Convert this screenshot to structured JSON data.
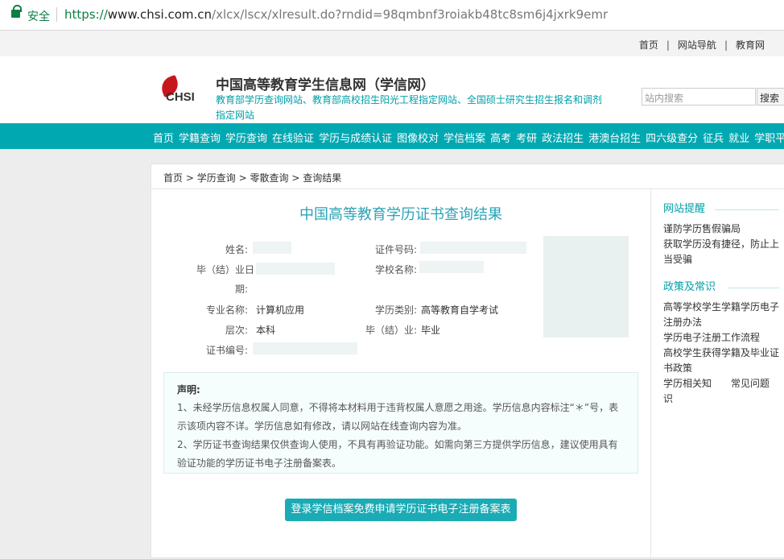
{
  "browser": {
    "secure_label": "安全",
    "url_scheme": "https://",
    "url_domain": "www.chsi.com.cn",
    "url_path": "/xlcx/lscx/xlresult.do?rndid=98qmbnf3roiakb48tc8sm6j4jxrk9emr"
  },
  "topnav": {
    "items": [
      "首页",
      "网站导航",
      "教育网"
    ],
    "divider": "|"
  },
  "header": {
    "logo_text": "CHSI",
    "title": "中国高等教育学生信息网（学信网）",
    "subtitle": "教育部学历查询网站、教育部高校招生阳光工程指定网站、全国硕士研究生招生报名和调剂指定网站",
    "search_placeholder": "站内搜索",
    "search_button": "搜索"
  },
  "mainnav": {
    "items": [
      "首页",
      "学籍查询",
      "学历查询",
      "在线验证",
      "学历与成绩认证",
      "图像校对",
      "学信档案",
      "高考",
      "考研",
      "政法招生",
      "港澳台招生",
      "四六级查分",
      "征兵",
      "就业",
      "学职平台"
    ]
  },
  "breadcrumb": {
    "items": [
      "首页",
      "学历查询",
      "零散查询",
      "查询结果"
    ],
    "sep": ">"
  },
  "result": {
    "title": "中国高等教育学历证书查询结果",
    "labels": {
      "name": "姓名:",
      "id_number": "证件号码:",
      "grad_date_a": "毕（结）业日",
      "grad_date_b": "期:",
      "school": "学校名称:",
      "major": "专业名称:",
      "edu_type": "学历类别:",
      "level": "层次:",
      "grad_status": "毕（结）业:",
      "cert_no": "证书编号:"
    },
    "values": {
      "major": "计算机应用",
      "edu_type": "高等教育自学考试",
      "level": "本科",
      "grad_status": "毕业"
    }
  },
  "notice": {
    "heading": "声明:",
    "line1": "1、未经学历信息权属人同意，不得将本材料用于违背权属人意愿之用途。学历信息内容标注“＊”号，表示该项内容不详。学历信息如有修改，请以网站在线查询内容为准。",
    "line2": "2、学历证书查询结果仅供查询人使用，不具有再验证功能。如需向第三方提供学历信息，建议使用具有验证功能的学历证书电子注册备案表。"
  },
  "apply_button": "登录学信档案免费申请学历证书电子注册备案表",
  "sidebar": {
    "reminder_title": "网站提醒",
    "reminder_items": [
      "谨防学历售假骗局",
      "获取学历没有捷径，防止上当受骗"
    ],
    "policy_title": "政策及常识",
    "policy_items": [
      "高等学校学生学籍学历电子注册办法",
      "学历电子注册工作流程",
      "高校学生获得学籍及毕业证书政策",
      "学历相关知识",
      "常见问题"
    ]
  }
}
